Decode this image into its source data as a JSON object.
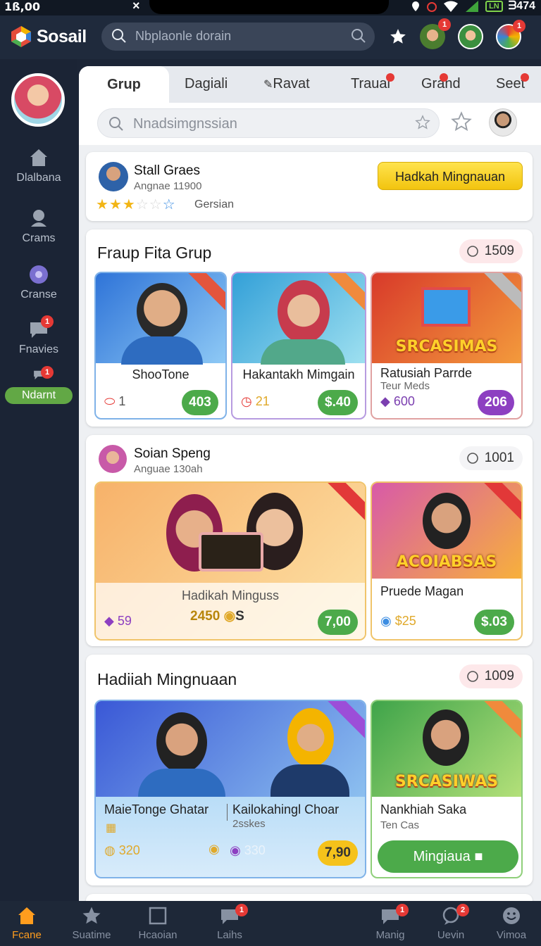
{
  "status": {
    "time": "1ß,00",
    "close": "×",
    "battery_label": "LN",
    "battery": "ᗱ474"
  },
  "appbar": {
    "brand": "Sosail",
    "search_placeholder": "Nbplaonle dorain",
    "badge_a": "1",
    "badge_b": "1"
  },
  "sidebar": {
    "items": [
      {
        "label": "Dlalbana",
        "icon": "home-icon"
      },
      {
        "label": "Crams",
        "icon": "group-icon"
      },
      {
        "label": "Cranse",
        "icon": "globe-icon"
      },
      {
        "label": "Fnavies",
        "icon": "chat-icon",
        "badge": "1"
      },
      {
        "label": "Ndarnt",
        "icon": "chat-icon",
        "badge": "1"
      }
    ]
  },
  "tabs": [
    "Grup",
    "Dagiali",
    "Ravat",
    "Traual",
    "Grand",
    "Seet"
  ],
  "search_main": {
    "placeholder": "Nnadsimgnssian"
  },
  "user_card": {
    "name": "Stall Graes",
    "sub": "Angnae 11900",
    "tag": "Gersian",
    "button": "Hadkah Mingnauan",
    "rating": 3
  },
  "section1": {
    "title": "Fraup Fita Grup",
    "count": "1509",
    "cards": [
      {
        "title": "ShooTone",
        "value": "1",
        "pill": "403"
      },
      {
        "title": "Hakantakh Mimgain",
        "value": "21",
        "pill": "$.40"
      },
      {
        "title": "Ratusiah Parrde",
        "sub": "Teur Meds",
        "value": "600",
        "pill": "206",
        "banner": "SRCASIMAS"
      }
    ]
  },
  "section2": {
    "name": "Soian Speng",
    "sub": "Anguae 130ah",
    "count": "1001",
    "cards": [
      {
        "title": "Hadikah Minguss",
        "value": "59",
        "value2": "2450",
        "value2_suffix": "S",
        "pill": "7,00"
      },
      {
        "title": "Pruede Magan",
        "value": "$25",
        "pill": "$.03",
        "banner": "ACOIABSAS"
      }
    ]
  },
  "section3": {
    "title": "Hadiiah Mingnuaan",
    "count": "1009",
    "cards": [
      {
        "title": "MaieTonge Ghatar",
        "title2": "Kailokahingl Choar",
        "sub2": "2sskes",
        "value": "320",
        "value2": "330",
        "pill": "7,90"
      },
      {
        "title": "Nankhiah Saka",
        "sub": "Ten Cas",
        "button": "Mingiaua",
        "banner": "SRCASIWAS"
      }
    ]
  },
  "bottom_nav": [
    {
      "label": "Fcane",
      "active": true
    },
    {
      "label": "Suatime"
    },
    {
      "label": "Hcaoian"
    },
    {
      "label": "Laihs",
      "badge": "1"
    },
    {
      "label": "Manig",
      "badge": "1"
    },
    {
      "label": "Uevin",
      "badge": "2"
    },
    {
      "label": "Vimoa"
    }
  ]
}
